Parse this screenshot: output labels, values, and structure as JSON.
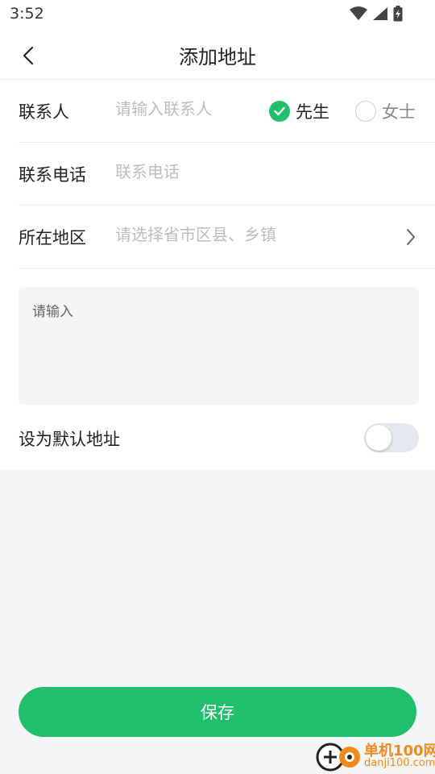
{
  "status_bar": {
    "time": "3:52",
    "icons": [
      "wifi-icon",
      "signal-icon",
      "battery-charging-icon"
    ]
  },
  "header": {
    "title": "添加地址",
    "back_icon": "chevron-left-icon"
  },
  "form": {
    "contact": {
      "label": "联系人",
      "placeholder": "请输入联系人",
      "gender_options": [
        {
          "label": "先生",
          "selected": true
        },
        {
          "label": "女士",
          "selected": false
        }
      ]
    },
    "phone": {
      "label": "联系电话",
      "placeholder": "联系电话"
    },
    "region": {
      "label": "所在地区",
      "placeholder": "请选择省市区县、乡镇",
      "icon": "chevron-right-icon"
    },
    "detail": {
      "placeholder": "请输入"
    },
    "default_address": {
      "label": "设为默认地址",
      "enabled": false
    }
  },
  "save_button": {
    "label": "保存"
  },
  "watermark": {
    "text": "单机100网",
    "subtext": "danji100.com"
  },
  "colors": {
    "accent": "#20bf6b",
    "background": "#f4f5f7",
    "placeholder": "#bdbdbd"
  }
}
